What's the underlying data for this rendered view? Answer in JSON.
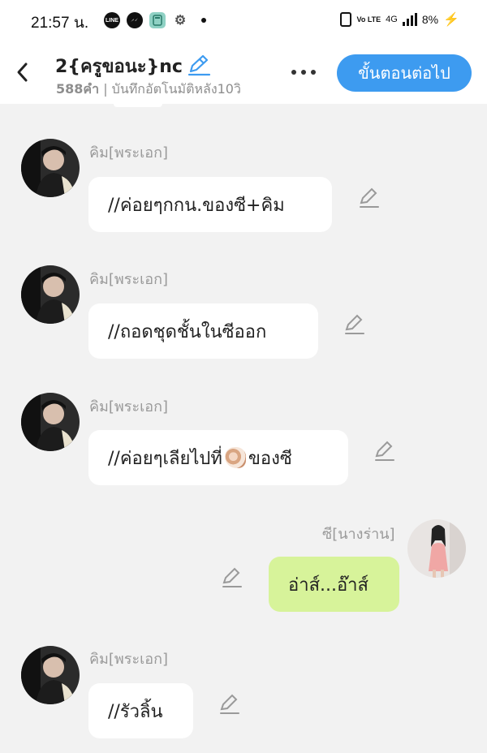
{
  "status_bar": {
    "time": "21:57 น.",
    "apps": [
      "LINE",
      "messenger-icon",
      "calculator-icon",
      "game-icon"
    ],
    "network": "4G",
    "volte": "Vo LTE",
    "battery": "8%"
  },
  "header": {
    "title": "2{ครูขอนะ}nc",
    "word_count": "588คำ",
    "autosave": "| บันทึกอัตโนมัติหลัง10วิ",
    "next_button": "ขั้นตอนต่อไป"
  },
  "messages": [
    {
      "sender": "คิม[พระเอก]",
      "text": "//ค่อยๆกกน.ของซี+คิม",
      "side": "left"
    },
    {
      "sender": "คิม[พระเอก]",
      "text": "//ถอดชุดชั้นในซีออก",
      "side": "left"
    },
    {
      "sender": "คิม[พระเอก]",
      "text_before": "//ค่อยๆเลียไปที่",
      "emoji": "shell-emoji",
      "text_after": "ของซี",
      "side": "left"
    },
    {
      "sender": "ซี[นางร่าน]",
      "text": "อ่าส์...อ๊าส์",
      "side": "right"
    },
    {
      "sender": "คิม[พระเอก]",
      "text": "//รัวลิ้น",
      "side": "left"
    }
  ],
  "colors": {
    "accent": "#3d9bf0",
    "background": "#f2f2f2",
    "bubble_left": "#ffffff",
    "bubble_right": "#d7f39a",
    "sender_text": "#9a9a9a"
  }
}
